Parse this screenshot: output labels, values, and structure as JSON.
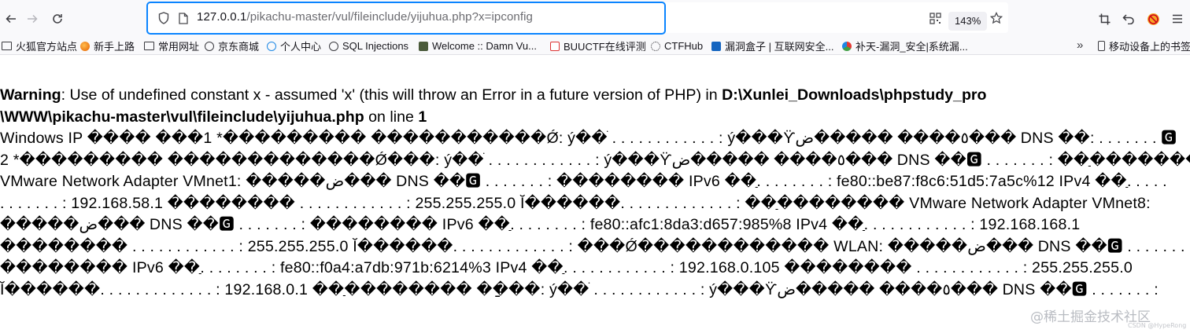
{
  "browser": {
    "url_host": "127.0.0.1",
    "url_path": "/pikachu-master/vul/fileinclude/yijuhua.php?x=ipconfig",
    "zoom_level": "143%",
    "accent_color": "#0a84ff"
  },
  "bookmarks": [
    {
      "label": "火狐官方站点",
      "icon": "folder-icon"
    },
    {
      "label": "新手上路",
      "icon": "firefox-icon"
    },
    {
      "label": "常用网址",
      "icon": "folder-icon"
    },
    {
      "label": "京东商城",
      "icon": "globe-icon"
    },
    {
      "label": "个人中心",
      "icon": "globe-icon"
    },
    {
      "label": "SQL Injections",
      "icon": "globe-icon"
    },
    {
      "label": "Welcome :: Damn Vu...",
      "icon": "dvwa-icon"
    },
    {
      "label": "BUUCTF在线评测",
      "icon": "buu-icon"
    },
    {
      "label": "CTFHub",
      "icon": "ctfhub-icon"
    },
    {
      "label": "漏洞盒子 | 互联网安全...",
      "icon": "box-icon"
    },
    {
      "label": "补天-漏洞_安全|系统漏...",
      "icon": "butian-icon"
    }
  ],
  "mobile_bookmarks": "移动设备上的书签",
  "warning": {
    "label": "Warning",
    "message": ": Use of undefined constant x - assumed 'x' (this will throw an Error in a future version of PHP) in ",
    "path_part1": "D:\\Xunlei_Downloads\\phpstudy_pro",
    "path_part2": "\\WWW\\pikachu-master\\vul\\fileinclude\\yijuhua.php",
    "on_line": " on line ",
    "line_number": "1"
  },
  "output_lines": [
    "Windows IP ���� ���1 *��������� �����������Ǿ: ý��ֺ . . . . . . . . . . . . : ý���ϔ٥���� �����ض��� DNS ��: . . . . . . . 🅶",
    "2 *��������� �������������Ǿ���: ý��ֺ . . . . . . . . . . . . : ý���ϔ٥���� �����ض��� DNS ��🅶 . . . . . . . : ��ַ��������",
    "VMware Network Adapter VMnet1: �����ض��� DNS ��🅶 . . . . . . . : �������� IPv6 ��ַ. . . . . . . . : fe80::be87:f8c6:51d5:7a5c%12 IPv4 ��ַ. . . . .",
    ". . . . . . . : 192.168.58.1 �������� . . . . . . . . . . . . : 255.255.255.0 Ĭ������. . . . . . . . . . . . . : ��ַ�������� VMware Network Adapter VMnet8:",
    "�����ض��� DNS ��🅶 . . . . . . . : �������� IPv6 ��ַ. . . . . . . . : fe80::afc1:8da3:d657:985%8 IPv4 ��ַ. . . . . . . . . . . . : 192.168.168.1",
    "�������� . . . . . . . . . . . . : 255.255.255.0 Ĭ������. . . . . . . . . . . . . : ���Ǿ������������ WLAN: �����ض��� DNS ��🅶 . . . . . . . :",
    "�������� IPv6 ��ַ. . . . . . . . : fe80::f0a4:a7db:971b:6214%3 IPv4 ��ַ. . . . . . . . . . . . : 192.168.0.105 �������� . . . . . . . . . . . . : 255.255.255.0",
    "Ĭ������. . . . . . . . . . . . . : 192.168.0.1 ��ַ�������� ��ַ��: ý��ֺ . . . . . . . . . . . . : ý���ϔ٥���� �����ض��� DNS ��🅶 . . . . . . . :"
  ],
  "watermark": "@稀土掘金技术社区",
  "watermark_small": "CSDN @HypeRong"
}
